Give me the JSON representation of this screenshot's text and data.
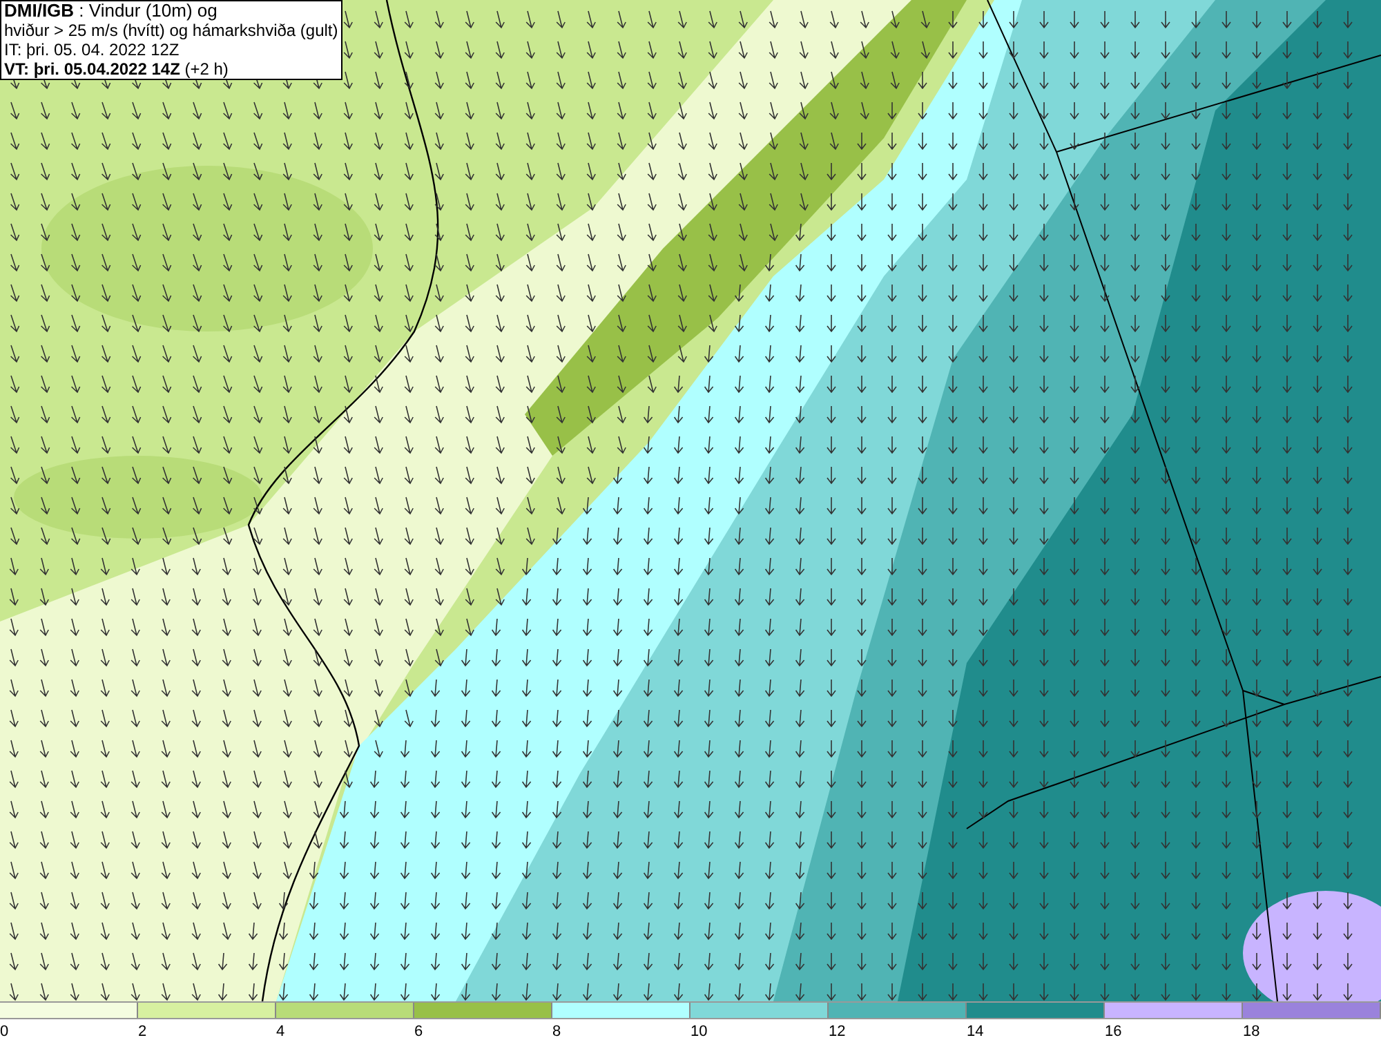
{
  "info": {
    "lines": [
      "**DMI/IGB** : Vindur (10m) og",
      "hviður > 25 m/s (hvítt) og hámarkshviða (gult)",
      "IT: þri. 05. 04. 2022 12Z",
      "**VT: þri. 05.04.2022 14Z** (+2 h)"
    ]
  },
  "legend": {
    "bins": [
      {
        "color": "#f4fde0"
      },
      {
        "color": "#d7f0a0"
      },
      {
        "color": "#b8dc78"
      },
      {
        "color": "#98c048"
      },
      {
        "color": "#b0ffff"
      },
      {
        "color": "#80d8d8"
      },
      {
        "color": "#50b4b4"
      },
      {
        "color": "#208c8c"
      },
      {
        "color": "#c8b4ff"
      },
      {
        "color": "#9a82dc"
      }
    ],
    "ticks": [
      "0",
      "2",
      "4",
      "6",
      "8",
      "10",
      "12",
      "14",
      "16",
      "18"
    ]
  }
}
